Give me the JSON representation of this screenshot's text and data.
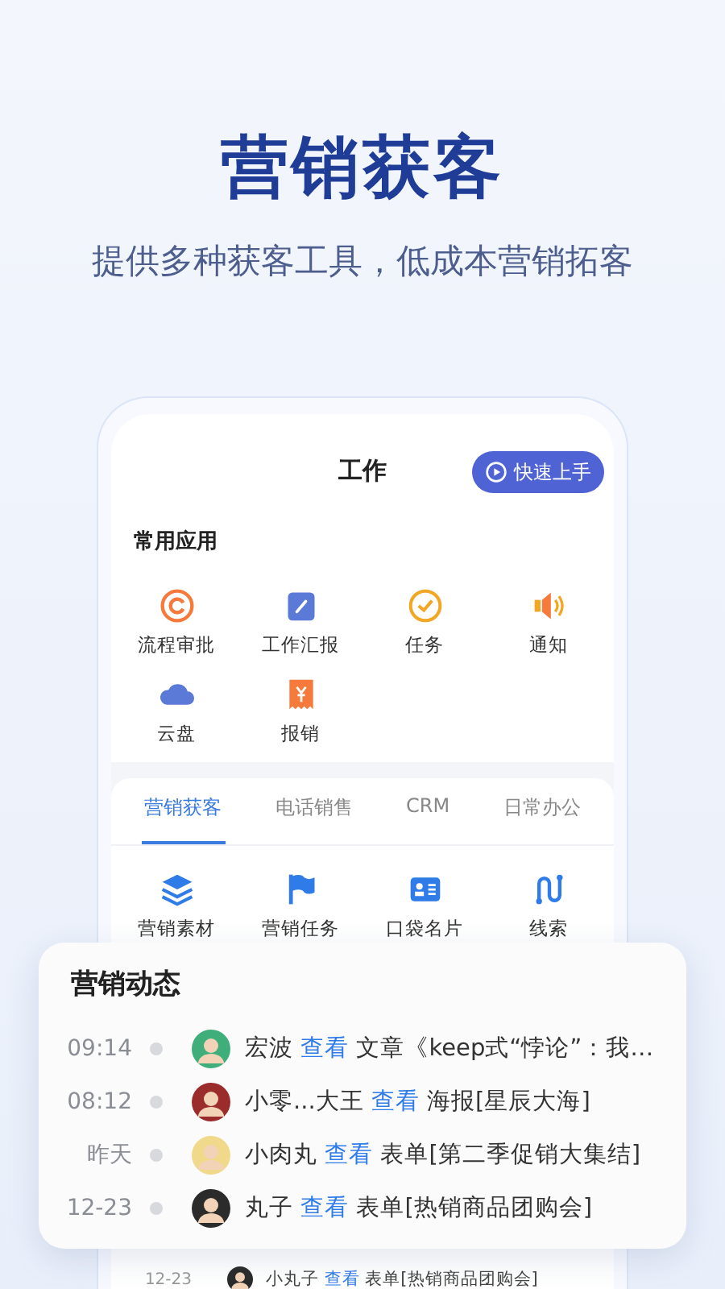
{
  "hero": {
    "title": "营销获客",
    "subtitle": "提供多种获客工具，低成本营销拓客"
  },
  "screen": {
    "title": "工作",
    "quick_button": "快速上手",
    "section_title": "常用应用",
    "apps": [
      {
        "label": "流程审批",
        "kind": "approval"
      },
      {
        "label": "工作汇报",
        "kind": "report"
      },
      {
        "label": "任务",
        "kind": "task"
      },
      {
        "label": "通知",
        "kind": "notice"
      },
      {
        "label": "云盘",
        "kind": "cloud"
      },
      {
        "label": "报销",
        "kind": "expense"
      }
    ],
    "tabs": [
      {
        "label": "营销获客",
        "selected": true
      },
      {
        "label": "电话销售",
        "selected": false
      },
      {
        "label": "CRM",
        "selected": false
      },
      {
        "label": "日常办公",
        "selected": false
      }
    ],
    "tools": [
      {
        "label": "营销素材",
        "kind": "layers"
      },
      {
        "label": "营销任务",
        "kind": "flag"
      },
      {
        "label": "口袋名片",
        "kind": "card"
      },
      {
        "label": "线索",
        "kind": "route"
      }
    ],
    "background_feed": [
      {
        "time": "12-23",
        "name": "小丸子",
        "action": "查看",
        "target": "表单[热销商品团购会]",
        "color": "#2b2b2b"
      }
    ]
  },
  "feed_card": {
    "title": "营销动态",
    "items": [
      {
        "time": "09:14",
        "name": "宏波",
        "action": "查看",
        "target": "文章《keep式“悖论”：我…",
        "color": "#3fae7a"
      },
      {
        "time": "08:12",
        "name": "小零...大王",
        "action": "查看",
        "target": "海报[星辰大海]",
        "color": "#9b2c2c"
      },
      {
        "time": "昨天",
        "name": "小肉丸",
        "action": "查看",
        "target": "表单[第二季促销大集结]",
        "color": "#f0d98a"
      },
      {
        "time": "12-23",
        "name": "丸子",
        "action": "查看",
        "target": "表单[热销商品团购会]",
        "color": "#2b2b2b"
      }
    ]
  }
}
